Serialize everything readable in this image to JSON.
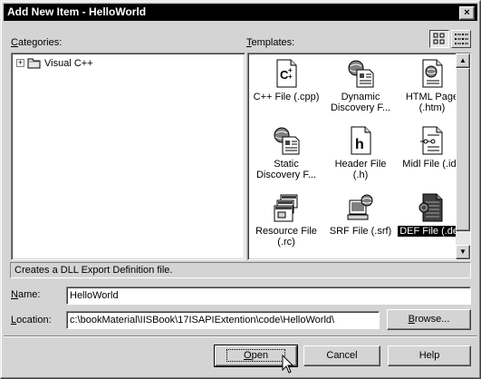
{
  "window": {
    "title": "Add New Item - HelloWorld",
    "close_glyph": "×"
  },
  "categories": {
    "label_accel": "C",
    "label_rest": "ategories:",
    "items": [
      {
        "label": "Visual C++",
        "expander": "+"
      }
    ]
  },
  "templates": {
    "label_accel": "T",
    "label_rest": "emplates:",
    "view_buttons": [
      {
        "name": "large-icons",
        "pressed": true
      },
      {
        "name": "list-view",
        "pressed": false
      }
    ],
    "items": [
      {
        "line1": "C++ File (.cpp)",
        "line2": "",
        "icon": "cpp-file-icon",
        "selected": false
      },
      {
        "line1": "Dynamic",
        "line2": "Discovery F...",
        "icon": "dynamic-discovery-icon",
        "selected": false
      },
      {
        "line1": "HTML Page",
        "line2": "(.htm)",
        "icon": "html-page-icon",
        "selected": false
      },
      {
        "line1": "Static",
        "line2": "Discovery F...",
        "icon": "static-discovery-icon",
        "selected": false
      },
      {
        "line1": "Header File",
        "line2": "(.h)",
        "icon": "header-file-icon",
        "selected": false
      },
      {
        "line1": "Midl File (.idl)",
        "line2": "",
        "icon": "midl-file-icon",
        "selected": false
      },
      {
        "line1": "Resource File",
        "line2": "(.rc)",
        "icon": "resource-file-icon",
        "selected": false
      },
      {
        "line1": "SRF File (.srf)",
        "line2": "",
        "icon": "srf-file-icon",
        "selected": false
      },
      {
        "line1": "DEF File (.def)",
        "line2": "",
        "icon": "def-file-icon",
        "selected": true
      }
    ]
  },
  "description": "Creates a DLL Export Definition file.",
  "name": {
    "label_accel": "N",
    "label_rest": "ame:",
    "value": "HelloWorld"
  },
  "location": {
    "label_accel": "L",
    "label_rest": "ocation:",
    "value": "c:\\bookMaterial\\IISBook\\17ISAPIExtention\\code\\HelloWorld\\",
    "browse_accel": "B",
    "browse_rest": "rowse..."
  },
  "buttons": {
    "open_accel": "O",
    "open_rest": "pen",
    "cancel": "Cancel",
    "help": "Help"
  }
}
